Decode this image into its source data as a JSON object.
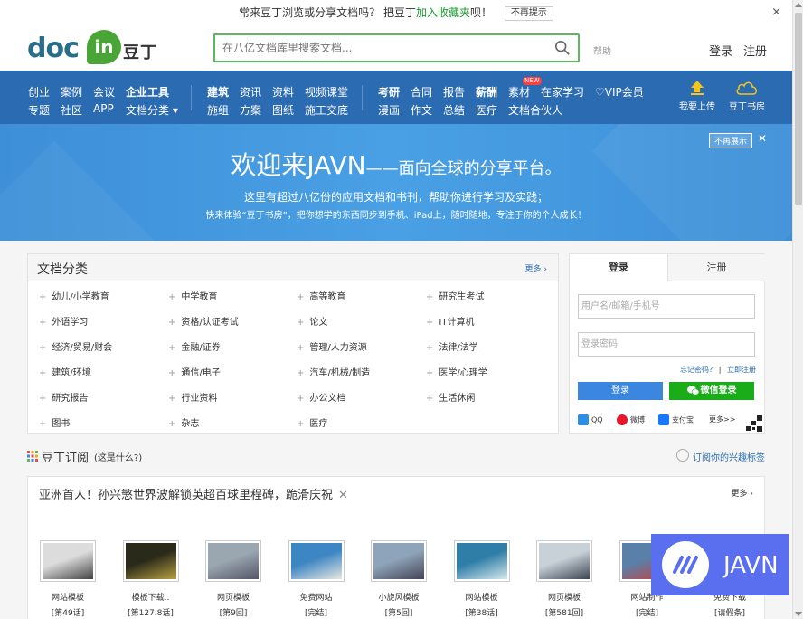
{
  "notice": {
    "text_prefix": "常来豆丁浏览或分享文档吗？ 把豆丁",
    "fav_link": "加入收藏夹",
    "text_suffix": "呗！",
    "nomore_label": "不再提示",
    "close_glyph": "×"
  },
  "header": {
    "logo_doc": "doc",
    "logo_in": "in",
    "logo_cn": "豆丁",
    "search_placeholder": "在八亿文档库里搜索文档...",
    "help": "帮助",
    "login": "登录",
    "register": "注册"
  },
  "nav": {
    "group1_row1": [
      "创业",
      "案例",
      "会议",
      "企业工具"
    ],
    "group1_row2": [
      "专题",
      "社区",
      "APP",
      "文档分类 ▾"
    ],
    "group2_row1": [
      "建筑",
      "资讯",
      "资料",
      "视频课堂"
    ],
    "group2_row2": [
      "施组",
      "方案",
      "图纸",
      "施工交底"
    ],
    "group3_row1": [
      "考研",
      "合同",
      "报告",
      "薪酬",
      "素材",
      "在家学习",
      "♡VIP会员"
    ],
    "group3_row2": [
      "漫画",
      "作文",
      "总结",
      "医疗",
      "文档合伙人"
    ],
    "new_badge": "NEW",
    "upload": "我要上传",
    "bookstore": "豆丁书房"
  },
  "banner": {
    "title_main": "欢迎来JAVN",
    "title_sub": "——面向全球的分享平台。",
    "line1": "这里有超过八亿份的应用文档和书刊，帮助你进行学习及实践；",
    "line2": "快来体验“豆丁书房”，把你想学的东西同步到手机、iPad上，随时随地，专注于你的个人成长！",
    "nomore": "不再展示",
    "close_glyph": "✕"
  },
  "categories": {
    "title": "文档分类",
    "more": "更多 ›",
    "items": [
      "幼儿/小学教育",
      "中学教育",
      "高等教育",
      "研究生考试",
      "外语学习",
      "资格/认证考试",
      "论文",
      "IT计算机",
      "经济/贸易/财会",
      "金融/证券",
      "管理/人力资源",
      "法律/法学",
      "建筑/环境",
      "通信/电子",
      "汽车/机械/制造",
      "医学/心理学",
      "研究报告",
      "行业资料",
      "办公文档",
      "生活休闲",
      "图书",
      "杂志",
      "医疗"
    ],
    "plus": "+"
  },
  "login_panel": {
    "tab_login": "登录",
    "tab_register": "注册",
    "username_placeholder": "用户名/邮箱/手机号",
    "password_placeholder": "登录密码",
    "forgot": "忘记密码?",
    "divider": "|",
    "signup_now": "立即注册",
    "login_btn": "登录",
    "wechat_btn": "微信登录",
    "qq": "QQ",
    "weibo": "微博",
    "alipay": "支付宝",
    "more": "更多>>"
  },
  "subscription": {
    "title": "豆丁订阅",
    "what": "(这是什么?)",
    "tag_link": "订阅你的兴趣标签"
  },
  "news": {
    "headline": "亚洲首人！孙兴慜世界波解锁英超百球里程碑，跪滑庆祝",
    "close_glyph": "✕",
    "more": "更多 ›",
    "items": [
      {
        "caption": "网站模板",
        "ep": "[第49话]"
      },
      {
        "caption": "模板下载..",
        "ep": "[第127.8话]"
      },
      {
        "caption": "网页模板",
        "ep": "[第9回]"
      },
      {
        "caption": "免费网站",
        "ep": "[完结]"
      },
      {
        "caption": "小旋风模板",
        "ep": "[第5回]"
      },
      {
        "caption": "网站模板",
        "ep": "[第38话]"
      },
      {
        "caption": "网页模板",
        "ep": "[第581回]"
      },
      {
        "caption": "网站制作",
        "ep": "[完结]"
      },
      {
        "caption": "免费下载",
        "ep": "[请假条]"
      }
    ]
  },
  "watermark": {
    "text": "JAVN"
  },
  "colors": {
    "nav_blue": "#2b6bb2",
    "banner_blue": "#4aa0e4",
    "green_accent": "#5cb85c",
    "wechat_green": "#1aad19",
    "watermark": "#5a6ef0"
  }
}
